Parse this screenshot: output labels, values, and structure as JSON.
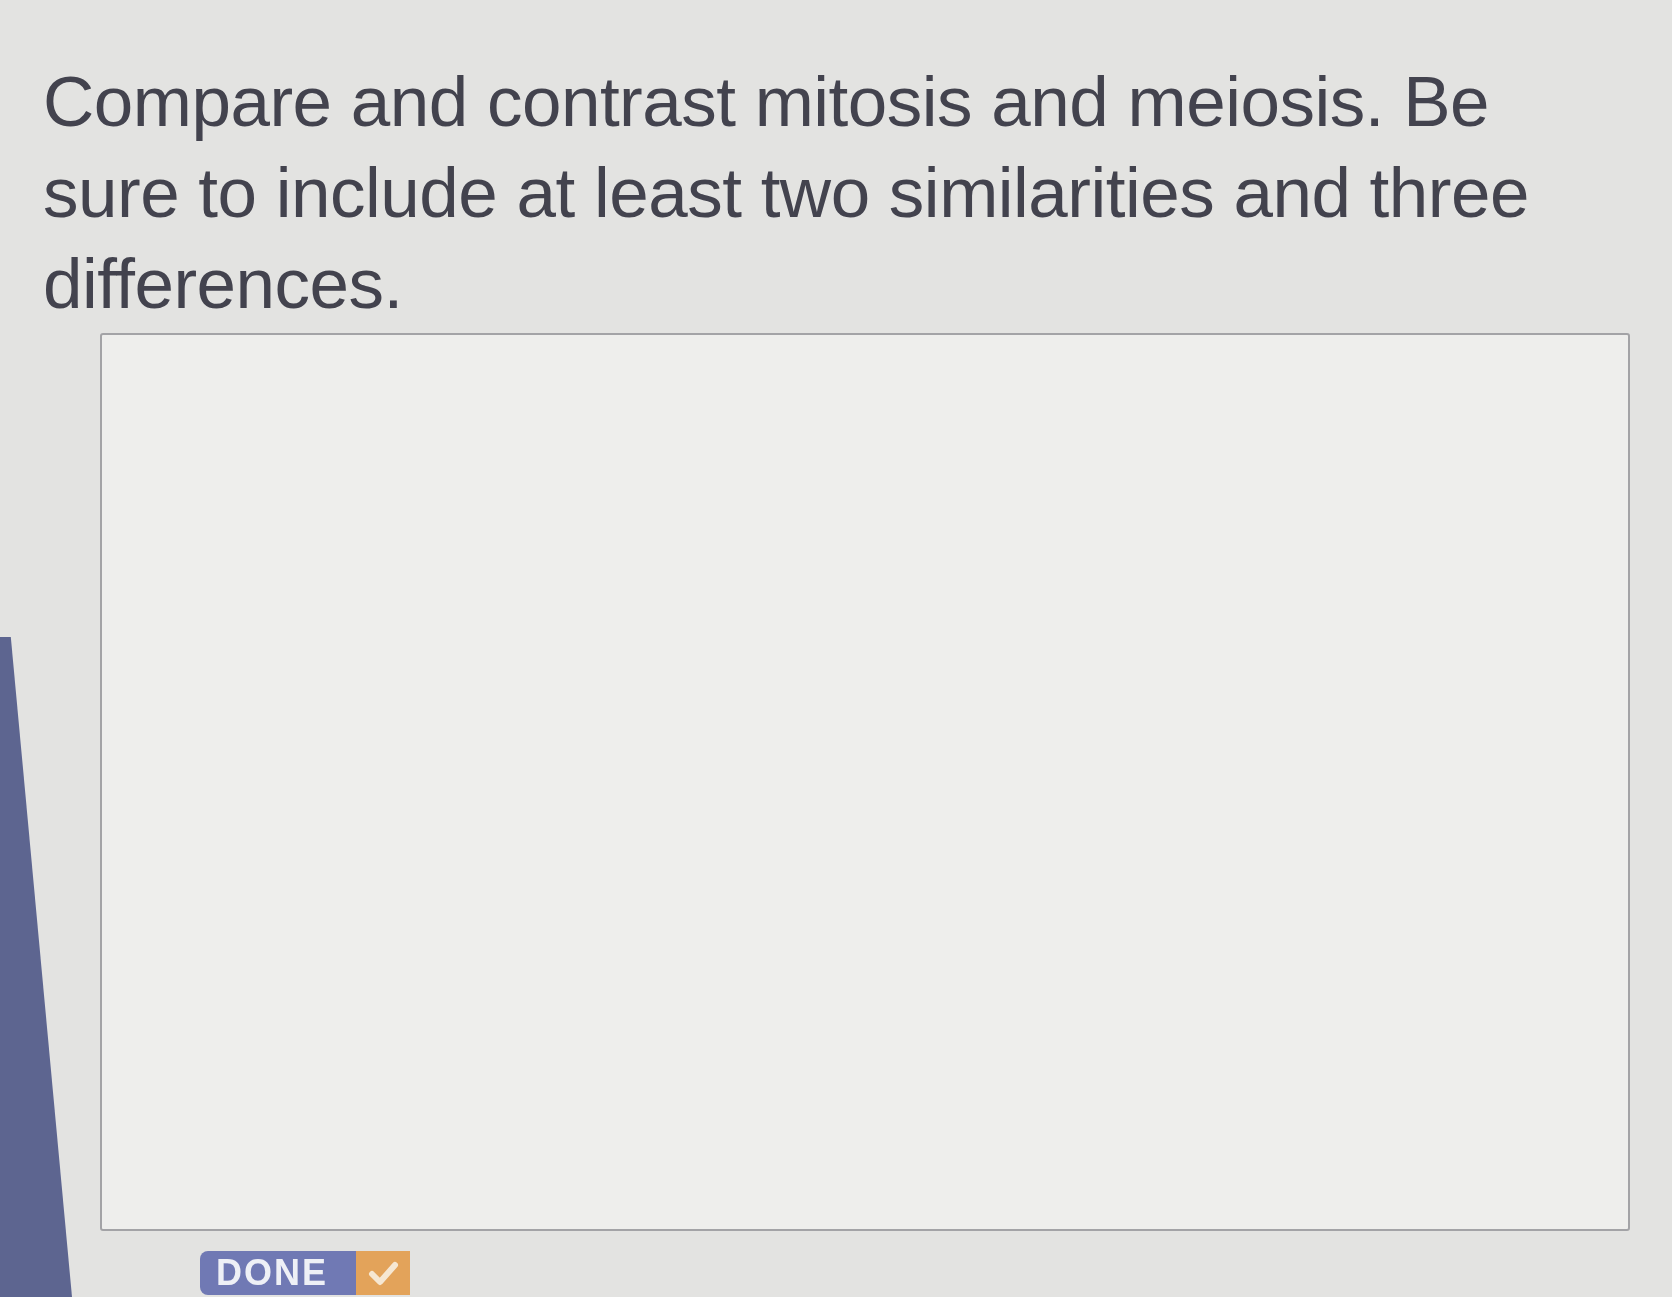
{
  "prompt": {
    "text": "Compare and contrast mitosis and meiosis. Be sure to include at least two similarities and three differences."
  },
  "done_button": {
    "label": "DONE"
  }
}
